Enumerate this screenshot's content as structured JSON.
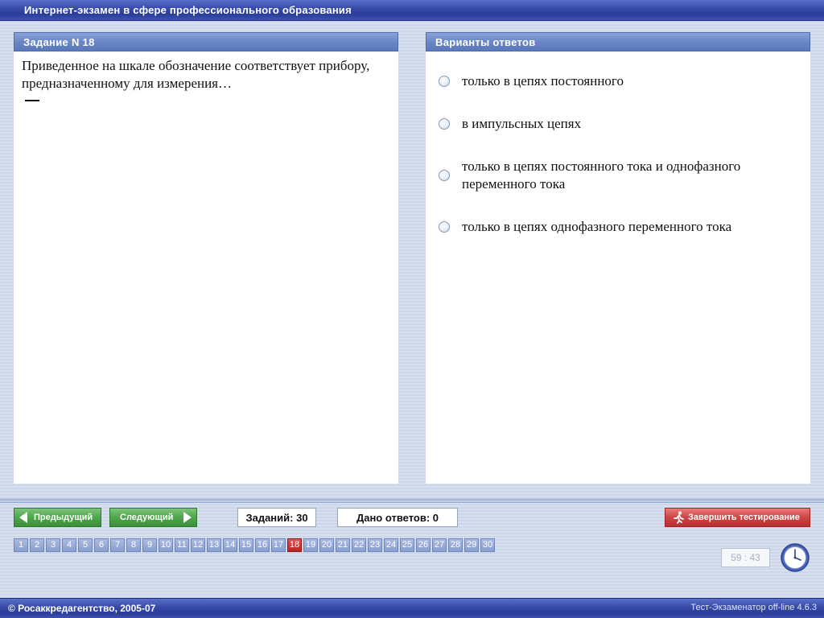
{
  "window": {
    "title": "Интернет-экзамен в сфере профессионального образования"
  },
  "question": {
    "header": "Задание N 18",
    "text": "Приведенное на шкале обозначение соответствует прибору, предназначенному для измерения…"
  },
  "answers": {
    "header": "Варианты ответов",
    "options": [
      "только в цепях постоянного",
      "в импульсных цепях",
      "только в цепях постоянного тока и однофазного переменного тока",
      "только в цепях однофазного переменного тока"
    ]
  },
  "nav": {
    "prev_label": "Предыдущий",
    "next_label": "Следующий",
    "tasks_label": "Заданий: 30",
    "answered_label": "Дано ответов: 0",
    "finish_label": "Завершить тестирование"
  },
  "pager": {
    "pages": [
      "1",
      "2",
      "3",
      "4",
      "5",
      "6",
      "7",
      "8",
      "9",
      "10",
      "11",
      "12",
      "13",
      "14",
      "15",
      "16",
      "17",
      "18",
      "19",
      "20",
      "21",
      "22",
      "23",
      "24",
      "25",
      "26",
      "27",
      "28",
      "29",
      "30"
    ],
    "current": "18"
  },
  "timer": {
    "value": "59 : 43"
  },
  "status": {
    "copyright": "© Росаккредагентство, 2005-07",
    "version": "Тест-Экзаменатор off-line 4.6.3"
  },
  "colors": {
    "titlebar": "#3548a6",
    "panel_header": "#6a86c6",
    "nav_button": "#4ea64c",
    "finish_button": "#cf4444",
    "current_page": "#b22222"
  }
}
